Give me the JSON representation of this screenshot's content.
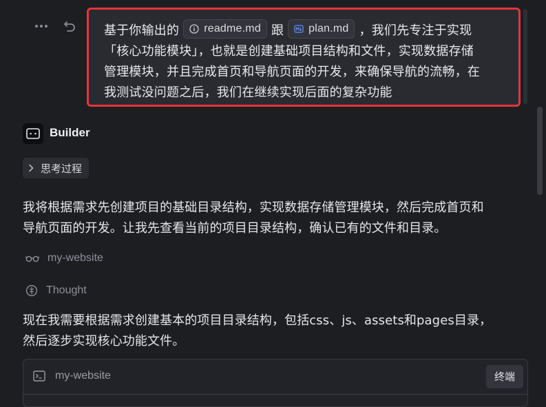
{
  "user_message": {
    "before_chip1": "基于你输出的",
    "chip1": "readme.md",
    "between": "跟",
    "chip2": "plan.md",
    "after_chips": "，我们先专注于实现",
    "line2": "「核心功能模块」，也就是创建基础项目结构和文件，实现数据存储",
    "line3": "管理模块，并且完成首页和导航页面的开发，来确保导航的流畅，在",
    "line4": "我测试没问题之后，我们在继续实现后面的复杂功能"
  },
  "agent": {
    "name": "Builder"
  },
  "thinking": {
    "label": "思考过程"
  },
  "response1": {
    "line1": "我将根据需求先创建项目的基础目录结构，实现数据存储管理模块，然后完成首页和",
    "line2": "导航页面的开发。让我先查看当前的项目目录结构，确认已有的文件和目录。"
  },
  "tool_view": {
    "label": "my-website"
  },
  "thought": {
    "label": "Thought"
  },
  "response2": {
    "line1": "现在我需要根据需求创建基本的项目目录结构，包括css、js、assets和pages目录，",
    "line2": "然后逐步实现核心功能文件。"
  },
  "terminal": {
    "name": "my-website",
    "button_label": "终端"
  },
  "icons": {
    "more": "more-horizontal-icon",
    "undo": "undo-icon",
    "info": "info-icon",
    "markdown": "markdown-file-icon",
    "agent": "builder-agent-icon",
    "chevron": "chevron-right-icon",
    "glasses": "glasses-icon",
    "thought": "thought-icon",
    "terminal": "terminal-icon"
  },
  "colors": {
    "highlight_border": "#e8333a",
    "background": "#1d1e22",
    "bubble": "#2a2b31"
  }
}
